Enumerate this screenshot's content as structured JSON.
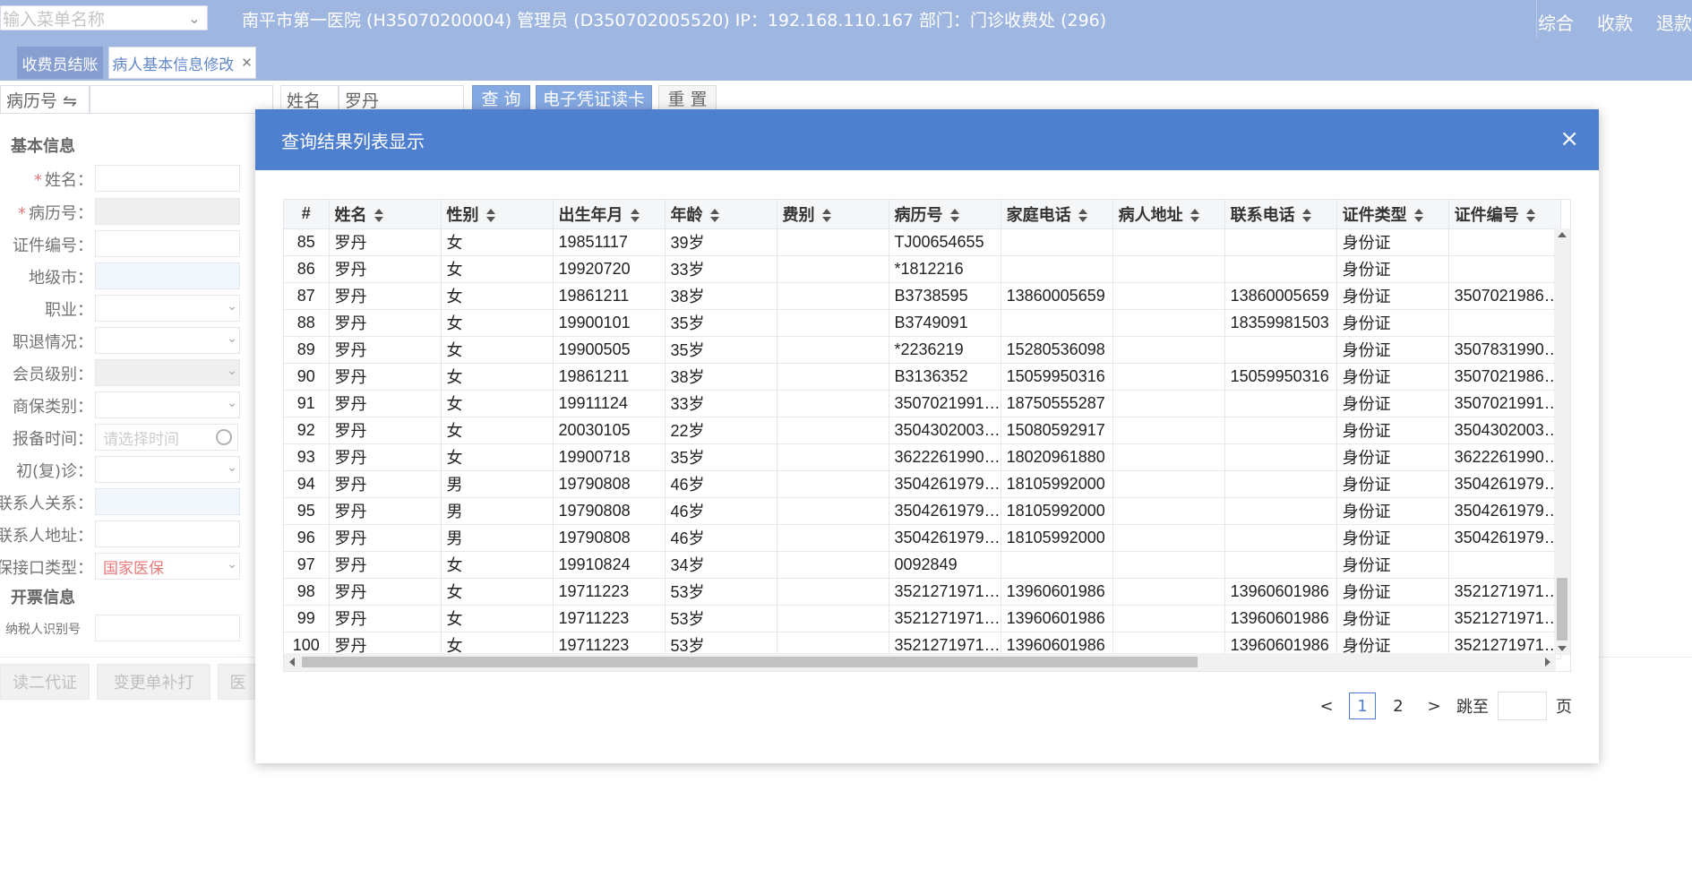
{
  "topbar": {
    "menu_search_placeholder": "输入菜单名称",
    "hospital_info": "南平市第一医院 (H35070200004) 管理员 (D350702005520) IP：192.168.110.167 部门：门诊收费处 (296)",
    "links": [
      "综合",
      "收款",
      "退款"
    ]
  },
  "tabs": [
    {
      "label": "收费员结账"
    },
    {
      "label": "病人基本信息修改"
    }
  ],
  "search": {
    "record_no_label": "病历号 ⇋",
    "name_label": "姓名",
    "name_value": "罗丹",
    "query_button": "查 询",
    "ecard_button": "电子凭证读卡",
    "reset_button": "重 置"
  },
  "left_panel": {
    "basic_title": "基本信息",
    "fields": [
      {
        "label": "姓名：",
        "required": true,
        "value": "",
        "style": "white"
      },
      {
        "label": "病历号：",
        "required": true,
        "value": "",
        "style": "gray"
      },
      {
        "label": "证件编号：",
        "required": false,
        "value": "",
        "style": "white"
      },
      {
        "label": "地级市：",
        "required": false,
        "value": "",
        "style": "blue"
      },
      {
        "label": "职业：",
        "required": false,
        "value": "",
        "style": "white"
      },
      {
        "label": "职退情况：",
        "required": false,
        "value": "",
        "style": "white"
      },
      {
        "label": "会员级别：",
        "required": false,
        "value": "",
        "style": "gray"
      },
      {
        "label": "商保类别：",
        "required": false,
        "value": "",
        "style": "white"
      },
      {
        "label": "报备时间：",
        "required": false,
        "value": "请选择时间",
        "style": "time"
      },
      {
        "label": "初(复)诊：",
        "required": false,
        "value": "",
        "style": "white"
      },
      {
        "label": "联系人关系：",
        "required": false,
        "value": "",
        "style": "blue"
      },
      {
        "label": "联系人地址：",
        "required": false,
        "value": "",
        "style": "white"
      },
      {
        "label": "医保接口类型：",
        "required": false,
        "value": "国家医保",
        "style": "red"
      }
    ],
    "invoice_title": "开票信息",
    "taxpayer_label": "纳税人识别号",
    "buttons": [
      "读二代证",
      "变更单补打",
      "医"
    ]
  },
  "modal": {
    "title": "查询结果列表显示",
    "close_glyph": "×",
    "columns": [
      "#",
      "姓名",
      "性别",
      "出生年月",
      "年龄",
      "费别",
      "病历号",
      "家庭电话",
      "病人地址",
      "联系电话",
      "证件类型",
      "证件编号"
    ],
    "rows": [
      [
        "85",
        "罗丹",
        "女",
        "19851117",
        "39岁",
        "",
        "TJ00654655",
        "",
        "",
        "",
        "身份证",
        ""
      ],
      [
        "86",
        "罗丹",
        "女",
        "19920720",
        "33岁",
        "",
        "*1812216",
        "",
        "",
        "",
        "身份证",
        ""
      ],
      [
        "87",
        "罗丹",
        "女",
        "19861211",
        "38岁",
        "",
        "B3738595",
        "13860005659",
        "",
        "13860005659",
        "身份证",
        "3507021986…"
      ],
      [
        "88",
        "罗丹",
        "女",
        "19900101",
        "35岁",
        "",
        "B3749091",
        "",
        "",
        "18359981503",
        "身份证",
        ""
      ],
      [
        "89",
        "罗丹",
        "女",
        "19900505",
        "35岁",
        "",
        "*2236219",
        "15280536098",
        "",
        "",
        "身份证",
        "3507831990…"
      ],
      [
        "90",
        "罗丹",
        "女",
        "19861211",
        "38岁",
        "",
        "B3136352",
        "15059950316",
        "",
        "15059950316",
        "身份证",
        "3507021986…"
      ],
      [
        "91",
        "罗丹",
        "女",
        "19911124",
        "33岁",
        "",
        "3507021991…",
        "18750555287",
        "",
        "",
        "身份证",
        "3507021991…"
      ],
      [
        "92",
        "罗丹",
        "女",
        "20030105",
        "22岁",
        "",
        "3504302003…",
        "15080592917",
        "",
        "",
        "身份证",
        "3504302003…"
      ],
      [
        "93",
        "罗丹",
        "女",
        "19900718",
        "35岁",
        "",
        "3622261990…",
        "18020961880",
        "",
        "",
        "身份证",
        "3622261990…"
      ],
      [
        "94",
        "罗丹",
        "男",
        "19790808",
        "46岁",
        "",
        "3504261979…",
        "18105992000",
        "",
        "",
        "身份证",
        "3504261979…"
      ],
      [
        "95",
        "罗丹",
        "男",
        "19790808",
        "46岁",
        "",
        "3504261979…",
        "18105992000",
        "",
        "",
        "身份证",
        "3504261979…"
      ],
      [
        "96",
        "罗丹",
        "男",
        "19790808",
        "46岁",
        "",
        "3504261979…",
        "18105992000",
        "",
        "",
        "身份证",
        "3504261979…"
      ],
      [
        "97",
        "罗丹",
        "女",
        "19910824",
        "34岁",
        "",
        "0092849",
        "",
        "",
        "",
        "身份证",
        ""
      ],
      [
        "98",
        "罗丹",
        "女",
        "19711223",
        "53岁",
        "",
        "3521271971…",
        "13960601986",
        "",
        "13960601986",
        "身份证",
        "3521271971…"
      ],
      [
        "99",
        "罗丹",
        "女",
        "19711223",
        "53岁",
        "",
        "3521271971…",
        "13960601986",
        "",
        "13960601986",
        "身份证",
        "3521271971…"
      ],
      [
        "100",
        "罗丹",
        "女",
        "19711223",
        "53岁",
        "",
        "3521271971…",
        "13960601986",
        "",
        "13960601986",
        "身份证",
        "3521271971…"
      ]
    ],
    "pager": {
      "prev": "<",
      "pages": [
        "1",
        "2"
      ],
      "current": "1",
      "next": ">",
      "jump_label": "跳至",
      "page_suffix": "页"
    }
  }
}
